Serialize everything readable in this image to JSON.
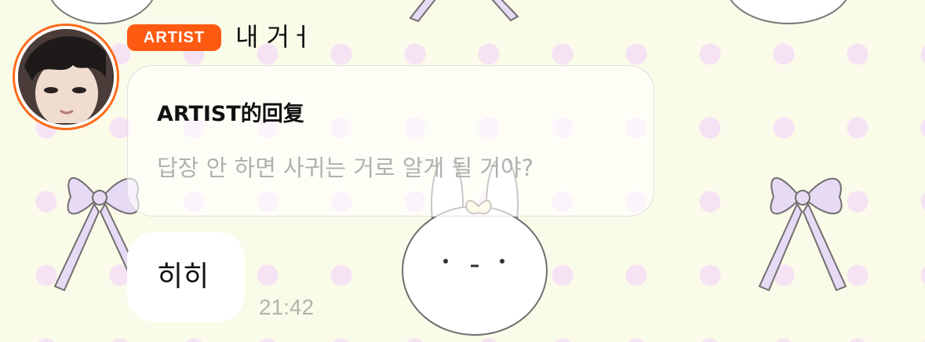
{
  "message": {
    "badge": "ARTIST",
    "sender": "내 거ㅓ",
    "reply": {
      "title": "ARTIST的回复",
      "quote": "답장 안 하면 사귀는 거로 알게 될 거야?"
    },
    "text": "히히",
    "time": "21:42"
  },
  "colors": {
    "badge_bg": "#ff5a12",
    "avatar_ring": "#ff6a1a",
    "background": "#fbfbe9",
    "polka_dot": "#f5e3f4",
    "ribbon": "#e7daf5",
    "quote_text": "#b0b0b0",
    "timestamp_text": "#b4b4aa"
  },
  "background_decorations": [
    "ribbon-bow",
    "bunny",
    "polka-dots"
  ]
}
